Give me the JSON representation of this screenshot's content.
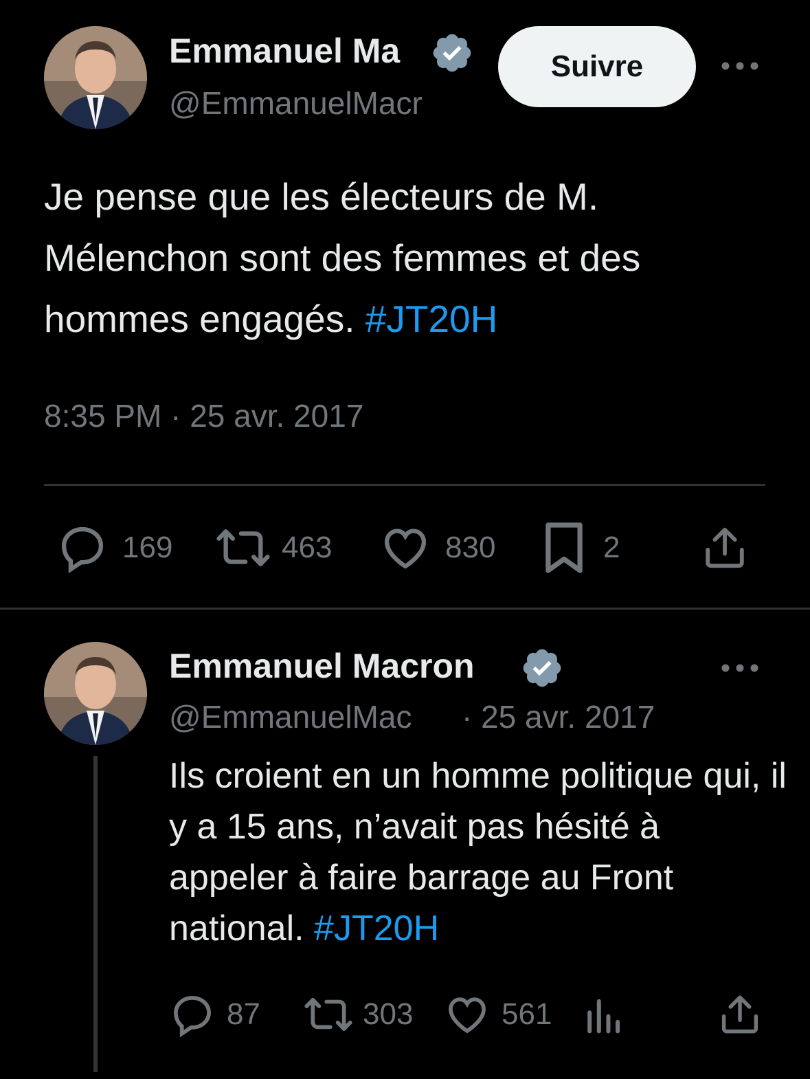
{
  "tweet1": {
    "author_name": "Emmanuel Ma",
    "author_handle": "@EmmanuelMacr",
    "follow_label": "Suivre",
    "text_before": "Je pense que les électeurs de M. Mélenchon sont des femmes et des hommes engagés. ",
    "hashtag": "#JT20H",
    "timestamp": "8:35 PM · 25 avr. 2017",
    "replies": "169",
    "retweets": "463",
    "likes": "830",
    "bookmarks": "2"
  },
  "tweet2": {
    "author_name": "Emmanuel Macron",
    "author_handle": "@EmmanuelMac",
    "date": "· 25 avr. 2017",
    "text_before": "Ils croient en un homme politique qui, il y a 15 ans, n’avait pas hésité à appeler à faire barrage au Front national. ",
    "hashtag": "#JT20H",
    "replies": "87",
    "retweets": "303",
    "likes": "561"
  },
  "colors": {
    "background": "#000000",
    "text": "#e7e9ea",
    "secondary": "#71767b",
    "accent": "#1d9bf0",
    "verified_badge": "#829aab"
  },
  "icons": {
    "verified": "verified-badge-icon",
    "more": "more-horizontal-icon",
    "reply": "reply-icon",
    "retweet": "retweet-icon",
    "like": "heart-icon",
    "bookmark": "bookmark-icon",
    "views": "analytics-icon",
    "share": "share-icon"
  }
}
